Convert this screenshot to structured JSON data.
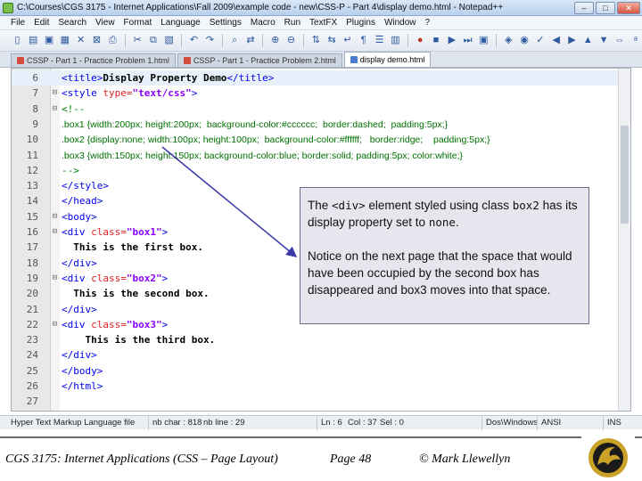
{
  "window": {
    "title": "C:\\Courses\\CGS 3175 - Internet Applications\\Fall 2009\\example code - new\\CSS-P - Part 4\\display demo.html - Notepad++",
    "minimize": "–",
    "maximize": "□",
    "close": "✕"
  },
  "menu": [
    "File",
    "Edit",
    "Search",
    "View",
    "Format",
    "Language",
    "Settings",
    "Macro",
    "Run",
    "TextFX",
    "Plugins",
    "Window",
    "?"
  ],
  "tabs": [
    {
      "label": "CSSP - Part 1 - Practice Problem 1.html",
      "active": false
    },
    {
      "label": "CSSP - Part 1 - Practice Problem 2.html",
      "active": false
    },
    {
      "label": "display demo.html",
      "active": true
    }
  ],
  "code_lines": [
    {
      "num": "6",
      "fold": "",
      "segments": [
        {
          "t": "tag",
          "s": "<title>"
        },
        {
          "t": "text",
          "s": "Display Property Demo"
        },
        {
          "t": "tag",
          "s": "</title>"
        }
      ]
    },
    {
      "num": "7",
      "fold": "⊟",
      "segments": [
        {
          "t": "tag",
          "s": "<style "
        },
        {
          "t": "attr",
          "s": "type="
        },
        {
          "t": "val",
          "s": "\"text/css\""
        },
        {
          "t": "tag",
          "s": ">"
        }
      ]
    },
    {
      "num": "8",
      "fold": "⊟",
      "segments": [
        {
          "t": "com",
          "s": "<!--"
        }
      ]
    },
    {
      "num": "9",
      "fold": "",
      "segments": [
        {
          "t": "css",
          "s": ".box1 {width:200px; height:200px;  background-color:#cccccc;  border:dashed;  padding:5px;}"
        }
      ]
    },
    {
      "num": "10",
      "fold": "",
      "segments": [
        {
          "t": "css",
          "s": ".box2 {display:none; width:100px; height:100px;  background-color:#ffffff;   border:ridge;    padding:5px;}"
        }
      ]
    },
    {
      "num": "11",
      "fold": "",
      "segments": [
        {
          "t": "css",
          "s": ".box3 {width:150px; height:150px; background-color:blue; border:solid; padding:5px; color:white;}"
        }
      ]
    },
    {
      "num": "12",
      "fold": "",
      "segments": [
        {
          "t": "com",
          "s": "-->"
        }
      ]
    },
    {
      "num": "13",
      "fold": "",
      "segments": [
        {
          "t": "tag",
          "s": "</style>"
        }
      ]
    },
    {
      "num": "14",
      "fold": "",
      "segments": [
        {
          "t": "tag",
          "s": "</head>"
        }
      ]
    },
    {
      "num": "15",
      "fold": "⊟",
      "segments": [
        {
          "t": "tag",
          "s": "<body>"
        }
      ]
    },
    {
      "num": "16",
      "fold": "⊟",
      "segments": [
        {
          "t": "tag",
          "s": "<div "
        },
        {
          "t": "attr",
          "s": "class="
        },
        {
          "t": "val",
          "s": "\"box1\""
        },
        {
          "t": "tag",
          "s": ">"
        }
      ]
    },
    {
      "num": "17",
      "fold": "",
      "segments": [
        {
          "t": "text",
          "s": "  This is the first box."
        }
      ]
    },
    {
      "num": "18",
      "fold": "",
      "segments": [
        {
          "t": "tag",
          "s": "</div>"
        }
      ]
    },
    {
      "num": "19",
      "fold": "⊟",
      "segments": [
        {
          "t": "tag",
          "s": "<div "
        },
        {
          "t": "attr",
          "s": "class="
        },
        {
          "t": "val",
          "s": "\"box2\""
        },
        {
          "t": "tag",
          "s": ">"
        }
      ]
    },
    {
      "num": "20",
      "fold": "",
      "segments": [
        {
          "t": "text",
          "s": "  This is the second box."
        }
      ]
    },
    {
      "num": "21",
      "fold": "",
      "segments": [
        {
          "t": "tag",
          "s": "</div>"
        }
      ]
    },
    {
      "num": "22",
      "fold": "⊟",
      "segments": [
        {
          "t": "tag",
          "s": "<div "
        },
        {
          "t": "attr",
          "s": "class="
        },
        {
          "t": "val",
          "s": "\"box3\""
        },
        {
          "t": "tag",
          "s": ">"
        }
      ]
    },
    {
      "num": "23",
      "fold": "",
      "segments": [
        {
          "t": "text",
          "s": "    This is the third box."
        }
      ]
    },
    {
      "num": "24",
      "fold": "",
      "segments": [
        {
          "t": "tag",
          "s": "</div>"
        }
      ]
    },
    {
      "num": "25",
      "fold": "",
      "segments": [
        {
          "t": "tag",
          "s": "</body>"
        }
      ]
    },
    {
      "num": "26",
      "fold": "",
      "segments": [
        {
          "t": "tag",
          "s": "</html>"
        }
      ]
    },
    {
      "num": "27",
      "fold": "",
      "segments": []
    }
  ],
  "callout": {
    "p1_a": "The ",
    "p1_code1": "<div>",
    "p1_b": " element styled using class ",
    "p1_code2": "box2",
    "p1_c": " has its display property set to ",
    "p1_code3": "none",
    "p1_d": ".",
    "p2": "Notice on the next page that the space that would have been occupied by the second box has disappeared and box3 moves into that space."
  },
  "status": {
    "file_type": "Hyper Text Markup Language file",
    "nb_char": "nb char : 818",
    "nb_line": "nb line : 29",
    "ln": "Ln : 6",
    "col": "Col : 37",
    "sel": "Sel : 0",
    "eol": "Dos\\Windows",
    "encoding": "ANSI",
    "mode": "INS"
  },
  "footer": {
    "course": "CGS 3175: Internet Applications (CSS – Page Layout)",
    "page": "Page 48",
    "author": "© Mark Llewellyn"
  },
  "colors": {
    "tag": "#0000ee",
    "attr": "#e02020",
    "value": "#8a00ff",
    "css": "#007000",
    "callout_bg": "#e6e6ef",
    "arrow": "#3a3aa8"
  }
}
